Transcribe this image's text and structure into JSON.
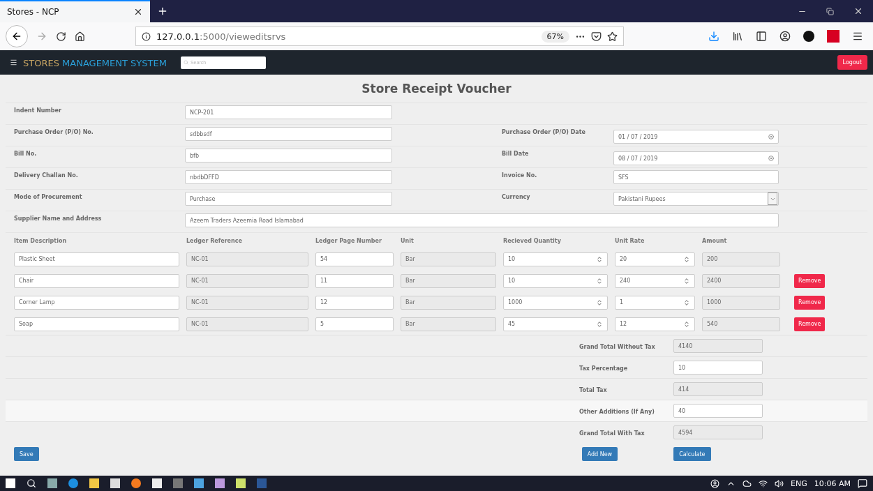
{
  "browser": {
    "tab_title": "Stores - NCP",
    "url_host": "127.0.0.1",
    "url_path": ":5000/vieweditsrvs",
    "zoom": "67%"
  },
  "navbar": {
    "brand_first": "STORES",
    "brand_second": "MANAGEMENT SYSTEM",
    "search_placeholder": "Search",
    "logout": "Logout"
  },
  "page_title": "Store Receipt Voucher",
  "header_rows": [
    {
      "left": {
        "label": "Indent Number",
        "value": "NCP-201",
        "kind": "text"
      }
    },
    {
      "left": {
        "label": "Purchase Order (P/O) No.",
        "value": "sdbbsdf",
        "kind": "text"
      },
      "right": {
        "label": "Purchase Order (P/O) Date",
        "value": "01 / 07 / 2019",
        "kind": "date"
      }
    },
    {
      "left": {
        "label": "Bill No.",
        "value": "bfb",
        "kind": "text"
      },
      "right": {
        "label": "Bill Date",
        "value": "08 / 07 / 2019",
        "kind": "date"
      }
    },
    {
      "left": {
        "label": "Delivery Challan No.",
        "value": "nbdbDFFD",
        "kind": "text"
      },
      "right": {
        "label": "Invoice No.",
        "value": "SFS",
        "kind": "text"
      }
    },
    {
      "left": {
        "label": "Mode of Procurement",
        "value": "Purchase",
        "kind": "text"
      },
      "right": {
        "label": "Currency",
        "value": "Pakistani Rupees",
        "kind": "select"
      }
    },
    {
      "left": {
        "label": "Supplier Name and Address",
        "value": "Azeem Traders Azeemia Road Islamabad",
        "kind": "wide"
      }
    }
  ],
  "items": {
    "columns": [
      {
        "label": "Item Description",
        "readonly": false,
        "kind": "text"
      },
      {
        "label": "Ledger Reference",
        "readonly": true,
        "kind": "text"
      },
      {
        "label": "Ledger Page Number",
        "readonly": false,
        "kind": "text"
      },
      {
        "label": "Unit",
        "readonly": true,
        "kind": "text"
      },
      {
        "label": "Recieved Quantity",
        "readonly": false,
        "kind": "number"
      },
      {
        "label": "Unit Rate",
        "readonly": false,
        "kind": "number"
      },
      {
        "label": "Amount",
        "readonly": true,
        "kind": "text"
      }
    ],
    "rows": [
      {
        "values": [
          "Plastic Sheet",
          "NC-01",
          "54",
          "Bar",
          "10",
          "20",
          "200"
        ]
      },
      {
        "values": [
          "Chair",
          "NC-01",
          "11",
          "Bar",
          "10",
          "240",
          "2400"
        ],
        "remove": "Remove"
      },
      {
        "values": [
          "Corner Lamp",
          "NC-01",
          "12",
          "Bar",
          "1000",
          "1",
          "1000"
        ],
        "remove": "Remove"
      },
      {
        "values": [
          "Soap",
          "NC-01",
          "5",
          "Bar",
          "45",
          "12",
          "540"
        ],
        "remove": "Remove"
      }
    ]
  },
  "totals": [
    {
      "label": "Grand Total Without Tax",
      "value": "4140",
      "readonly": true
    },
    {
      "label": "Tax Percentage",
      "value": "10",
      "readonly": false
    },
    {
      "label": "Total Tax",
      "value": "414",
      "readonly": true
    },
    {
      "label": "Other Additions (If Any)",
      "value": "40",
      "readonly": false
    },
    {
      "label": "Grand Total With Tax",
      "value": "4594",
      "readonly": true
    }
  ],
  "buttons": {
    "save": "Save",
    "add_new": "Add New",
    "calculate": "Calculate"
  },
  "taskbar": {
    "language": "ENG",
    "time": "10:06 AM"
  }
}
